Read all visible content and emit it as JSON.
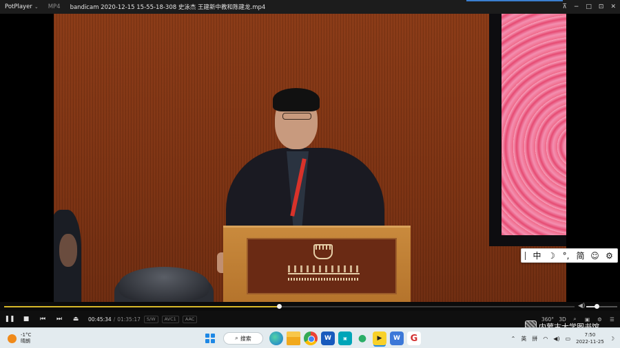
{
  "titlebar": {
    "brand": "PotPlayer",
    "format": "MP4",
    "file_title": "bandicam 2020-12-15 15-55-18-308 史泳杰 王建新中教和陈建龙.mp4",
    "controls": {
      "pin": "⊼",
      "minimize": "−",
      "maximize": "□",
      "fullscreen": "⊡",
      "close": "✕"
    }
  },
  "ime_toolbar": {
    "items": [
      "中",
      "☽",
      "°,",
      "简",
      "☺",
      "⚙"
    ]
  },
  "player": {
    "progress": 0.483,
    "volume": 0.35,
    "current_time": "00:45:34",
    "separator": "/",
    "total_time": "01:35:17",
    "tags": [
      "S/W",
      "AVC1",
      "AAC"
    ],
    "right_labels": [
      "360°",
      "3D"
    ],
    "colors": {
      "seek_fill": "#d8b92a",
      "background": "#0f0f0f"
    }
  },
  "watermark": {
    "text": "内蒙古大学图书馆"
  },
  "taskbar": {
    "weather_temp": "-1°C",
    "weather_desc": "晴朗",
    "search_label": "搜索",
    "tray_lang": "英",
    "tray_ime": "拼",
    "time": "7:50",
    "date": "2022-11-25"
  }
}
